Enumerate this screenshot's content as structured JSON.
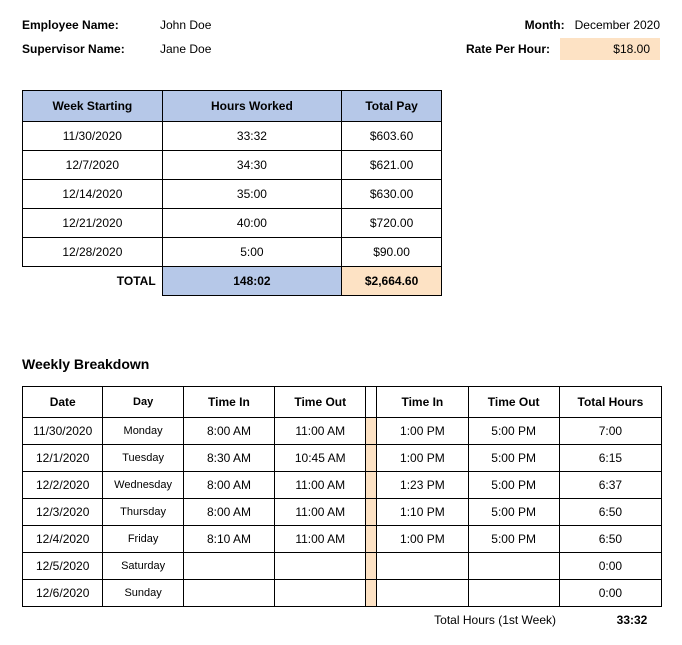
{
  "header": {
    "employee_name_label": "Employee Name:",
    "employee_name": "John Doe",
    "supervisor_name_label": "Supervisor Name:",
    "supervisor_name": "Jane Doe",
    "month_label": "Month:",
    "month": "December 2020",
    "rate_label": "Rate Per Hour:",
    "rate": "$18.00"
  },
  "summary": {
    "columns": {
      "week": "Week Starting",
      "hours": "Hours Worked",
      "pay": "Total Pay"
    },
    "rows": [
      {
        "week": "11/30/2020",
        "hours": "33:32",
        "pay": "$603.60"
      },
      {
        "week": "12/7/2020",
        "hours": "34:30",
        "pay": "$621.00"
      },
      {
        "week": "12/14/2020",
        "hours": "35:00",
        "pay": "$630.00"
      },
      {
        "week": "12/21/2020",
        "hours": "40:00",
        "pay": "$720.00"
      },
      {
        "week": "12/28/2020",
        "hours": "5:00",
        "pay": "$90.00"
      }
    ],
    "total_label": "TOTAL",
    "total_hours": "148:02",
    "total_pay": "$2,664.60"
  },
  "breakdown": {
    "title": "Weekly Breakdown",
    "columns": {
      "date": "Date",
      "day": "Day",
      "time_in": "Time In",
      "time_out": "Time Out",
      "total": "Total Hours"
    },
    "rows": [
      {
        "date": "11/30/2020",
        "day": "Monday",
        "in1": "8:00 AM",
        "out1": "11:00 AM",
        "in2": "1:00 PM",
        "out2": "5:00 PM",
        "total": "7:00"
      },
      {
        "date": "12/1/2020",
        "day": "Tuesday",
        "in1": "8:30 AM",
        "out1": "10:45 AM",
        "in2": "1:00 PM",
        "out2": "5:00 PM",
        "total": "6:15"
      },
      {
        "date": "12/2/2020",
        "day": "Wednesday",
        "in1": "8:00 AM",
        "out1": "11:00 AM",
        "in2": "1:23 PM",
        "out2": "5:00 PM",
        "total": "6:37"
      },
      {
        "date": "12/3/2020",
        "day": "Thursday",
        "in1": "8:00 AM",
        "out1": "11:00 AM",
        "in2": "1:10 PM",
        "out2": "5:00 PM",
        "total": "6:50"
      },
      {
        "date": "12/4/2020",
        "day": "Friday",
        "in1": "8:10 AM",
        "out1": "11:00 AM",
        "in2": "1:00 PM",
        "out2": "5:00 PM",
        "total": "6:50"
      },
      {
        "date": "12/5/2020",
        "day": "Saturday",
        "in1": "",
        "out1": "",
        "in2": "",
        "out2": "",
        "total": "0:00"
      },
      {
        "date": "12/6/2020",
        "day": "Sunday",
        "in1": "",
        "out1": "",
        "in2": "",
        "out2": "",
        "total": "0:00"
      }
    ],
    "footer_label": "Total Hours (1st Week)",
    "footer_value": "33:32"
  }
}
